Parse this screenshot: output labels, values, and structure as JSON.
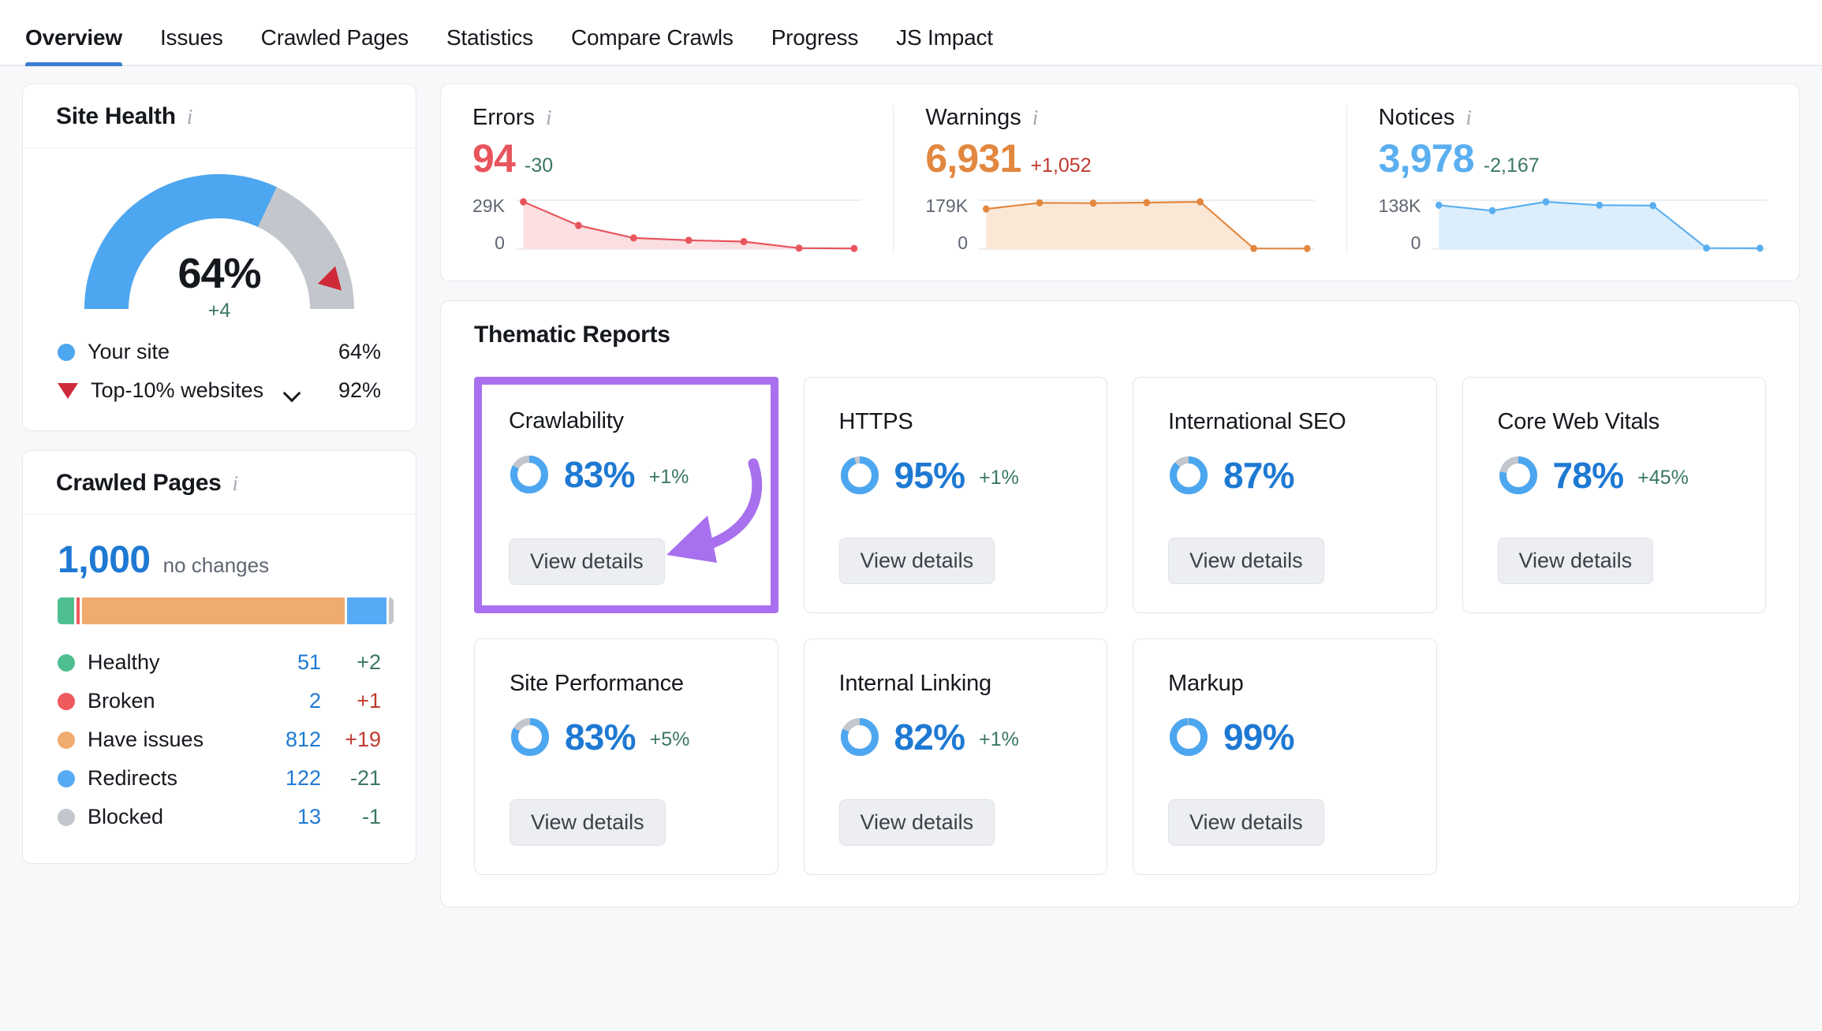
{
  "tabs": [
    {
      "label": "Overview",
      "active": true
    },
    {
      "label": "Issues",
      "active": false
    },
    {
      "label": "Crawled Pages",
      "active": false
    },
    {
      "label": "Statistics",
      "active": false
    },
    {
      "label": "Compare Crawls",
      "active": false
    },
    {
      "label": "Progress",
      "active": false
    },
    {
      "label": "JS Impact",
      "active": false
    }
  ],
  "site_health": {
    "title": "Site Health",
    "score": "64%",
    "delta": "+4",
    "legend": [
      {
        "label": "Your site",
        "value": "64%",
        "marker": "dot",
        "color": "#4da6f0"
      },
      {
        "label": "Top-10% websites",
        "value": "92%",
        "marker": "triangle",
        "color": "#cf2a3a",
        "has_chevron": true
      }
    ]
  },
  "crawled_pages": {
    "title": "Crawled Pages",
    "total": "1,000",
    "change": "no changes",
    "rows": [
      {
        "label": "Healthy",
        "count": "51",
        "delta": "+2",
        "delta_tone": "good",
        "color": "#4fbf91"
      },
      {
        "label": "Broken",
        "count": "2",
        "delta": "+1",
        "delta_tone": "bad",
        "color": "#ef5a5f"
      },
      {
        "label": "Have issues",
        "count": "812",
        "delta": "+19",
        "delta_tone": "bad",
        "color": "#f0ab6e"
      },
      {
        "label": "Redirects",
        "count": "122",
        "delta": "-21",
        "delta_tone": "good",
        "color": "#57aaf5"
      },
      {
        "label": "Blocked",
        "count": "13",
        "delta": "-1",
        "delta_tone": "good",
        "color": "#c3c7cd"
      }
    ]
  },
  "metrics": [
    {
      "name": "Errors",
      "value": "94",
      "delta": "-30",
      "delta_tone": "good",
      "color": "#e8555d",
      "fill": "#fbdfe1",
      "axis_top": "29K",
      "axis_bottom": "0",
      "chart_data": {
        "type": "line",
        "values": [
          29000,
          14500,
          6800,
          5400,
          4600,
          600,
          400
        ],
        "ymax": 29000
      }
    },
    {
      "name": "Warnings",
      "value": "6,931",
      "delta": "+1,052",
      "delta_tone": "bad",
      "color": "#e2873f",
      "fill": "#fbe7d6",
      "axis_top": "179K",
      "axis_bottom": "0",
      "chart_data": {
        "type": "line",
        "values": [
          152000,
          175000,
          174000,
          176000,
          179000,
          2500,
          2000
        ],
        "ymax": 179000
      }
    },
    {
      "name": "Notices",
      "value": "3,978",
      "delta": "-2,167",
      "delta_tone": "good",
      "color": "#5aaff0",
      "fill": "#dceefb",
      "axis_top": "138K",
      "axis_bottom": "0",
      "chart_data": {
        "type": "line",
        "values": [
          128000,
          112000,
          138000,
          128000,
          127000,
          3000,
          2500
        ],
        "ymax": 138000
      }
    }
  ],
  "thematic_reports": {
    "title": "Thematic Reports",
    "button_label": "View details",
    "cards": [
      {
        "title": "Crawlability",
        "pct": "83%",
        "value": 83,
        "delta": "+1%",
        "highlighted": true
      },
      {
        "title": "HTTPS",
        "pct": "95%",
        "value": 95,
        "delta": "+1%",
        "highlighted": false
      },
      {
        "title": "International SEO",
        "pct": "87%",
        "value": 87,
        "delta": "",
        "highlighted": false
      },
      {
        "title": "Core Web Vitals",
        "pct": "78%",
        "value": 78,
        "delta": "+45%",
        "highlighted": false
      },
      {
        "title": "Site Performance",
        "pct": "83%",
        "value": 83,
        "delta": "+5%",
        "highlighted": false
      },
      {
        "title": "Internal Linking",
        "pct": "82%",
        "value": 82,
        "delta": "+1%",
        "highlighted": false
      },
      {
        "title": "Markup",
        "pct": "99%",
        "value": 99,
        "delta": "",
        "highlighted": false
      }
    ]
  },
  "colors": {
    "accent_blue": "#1e79d3",
    "gauge_blue": "#4da6f0",
    "gauge_gray": "#c3c7cd",
    "highlight_purple": "#a870ee",
    "good_green": "#3a7861",
    "bad_red": "#c0392f"
  }
}
